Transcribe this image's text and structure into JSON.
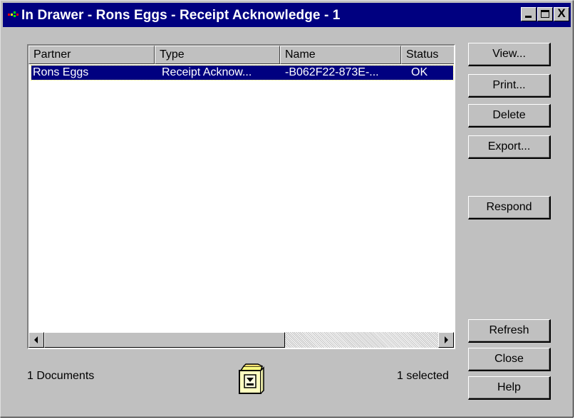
{
  "window": {
    "title": "In Drawer - Rons Eggs - Receipt Acknowledge - 1",
    "close_glyph": "X"
  },
  "list": {
    "columns": [
      "Partner",
      "Type",
      "Name",
      "Status"
    ],
    "rows": [
      {
        "partner": "Rons Eggs",
        "type": "Receipt Acknow...",
        "name": "-B062F22-873E-...",
        "status": "OK"
      }
    ]
  },
  "buttons": {
    "view": "View...",
    "print": "Print...",
    "delete": "Delete",
    "export": "Export...",
    "respond": "Respond",
    "refresh": "Refresh",
    "close": "Close",
    "help": "Help"
  },
  "status": {
    "count": "1 Documents",
    "selected": "1 selected"
  },
  "icons": {
    "app": "app-icon",
    "drawer": "file-cabinet-icon"
  },
  "colors": {
    "titlebar": "#000080",
    "selection": "#000080",
    "face": "#c0c0c0"
  }
}
